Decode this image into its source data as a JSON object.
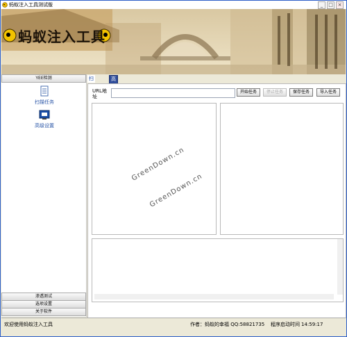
{
  "window": {
    "title": "蚂蚁注入工具测试版"
  },
  "banner": {
    "logo_text": "蚂蚁注入工具"
  },
  "sidebar": {
    "header": "YEE检测",
    "items": [
      {
        "label": "扫描任务",
        "icon": "document-icon"
      },
      {
        "label": "高级设置",
        "icon": "settings-screen-icon"
      }
    ],
    "bottom_buttons": [
      "渗透测试",
      "选项设置",
      "关于软件"
    ]
  },
  "tabs": [
    {
      "label": "扫描任务",
      "active": true
    },
    {
      "label": "高级设置",
      "selected": true
    }
  ],
  "toolbar": {
    "url_label": "URL地址",
    "url_value": "",
    "start": "开始任务",
    "stop": "停止任务",
    "save": "保存任务",
    "import": "导入任务"
  },
  "watermark": [
    "GreenDown.cn",
    "GreenDown.cn"
  ],
  "status": {
    "welcome": "欢迎使用蚂蚁注入工具",
    "author": "作者：蚂蚁的幸福 QQ:58821735",
    "start_time_label": "程序启动时间",
    "start_time": "14:59:17"
  },
  "colors": {
    "accent": "#2c57a8",
    "selected_tab": "#2e4c9a"
  }
}
